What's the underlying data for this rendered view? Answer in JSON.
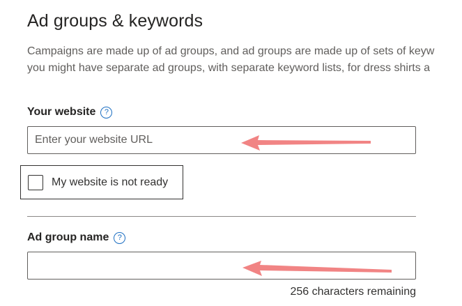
{
  "section": {
    "title": "Ad groups & keywords",
    "description_line1": "Campaigns are made up of ad groups, and ad groups are made up of sets of keyw",
    "description_line2": "you might have separate ad groups, with separate keyword lists, for dress shirts a"
  },
  "website": {
    "label": "Your website",
    "placeholder": "Enter your website URL",
    "value": "",
    "help_icon": "question-circle-icon"
  },
  "website_not_ready": {
    "label": "My website is not ready",
    "checked": false
  },
  "ad_group": {
    "label": "Ad group name",
    "value": "",
    "help_icon": "question-circle-icon",
    "remaining_text": "256 characters remaining"
  },
  "annotations": {
    "arrow_color": "#f07a7a"
  },
  "colors": {
    "help_icon": "#1b6ec2",
    "text": "#323130",
    "muted_text": "#605e5c"
  }
}
